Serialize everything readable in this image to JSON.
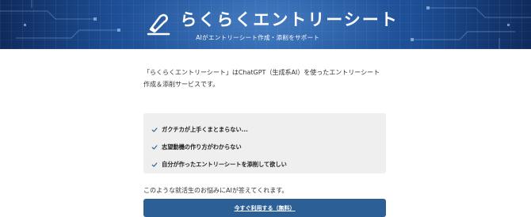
{
  "header": {
    "logo_icon": "pen-underline-logo",
    "title": "らくらくエントリーシート",
    "subtitle": "AIがエントリーシート作成・添削をサポート"
  },
  "main": {
    "intro": "「らくらくエントリーシート」はChatGPT（生成系AI）を使ったエントリーシート作成＆添削サービスです。",
    "checklist": [
      {
        "icon": "check-icon",
        "label": "ガクチカが上手くまとまらない..."
      },
      {
        "icon": "check-icon",
        "label": "志望動機の作り方がわからない"
      },
      {
        "icon": "check-icon",
        "label": "自分が作ったエントリーシートを添削して欲しい"
      }
    ],
    "lead": "このような就活生のお悩みにAIが答えてくれます。",
    "cta_label": "今すぐ利用する（無料）"
  },
  "colors": {
    "hero_primary": "#1d4f96",
    "hero_dark": "#0f2a5c",
    "cta": "#2b5f96",
    "check": "#2b5f96",
    "checklist_bg": "#efefef"
  }
}
